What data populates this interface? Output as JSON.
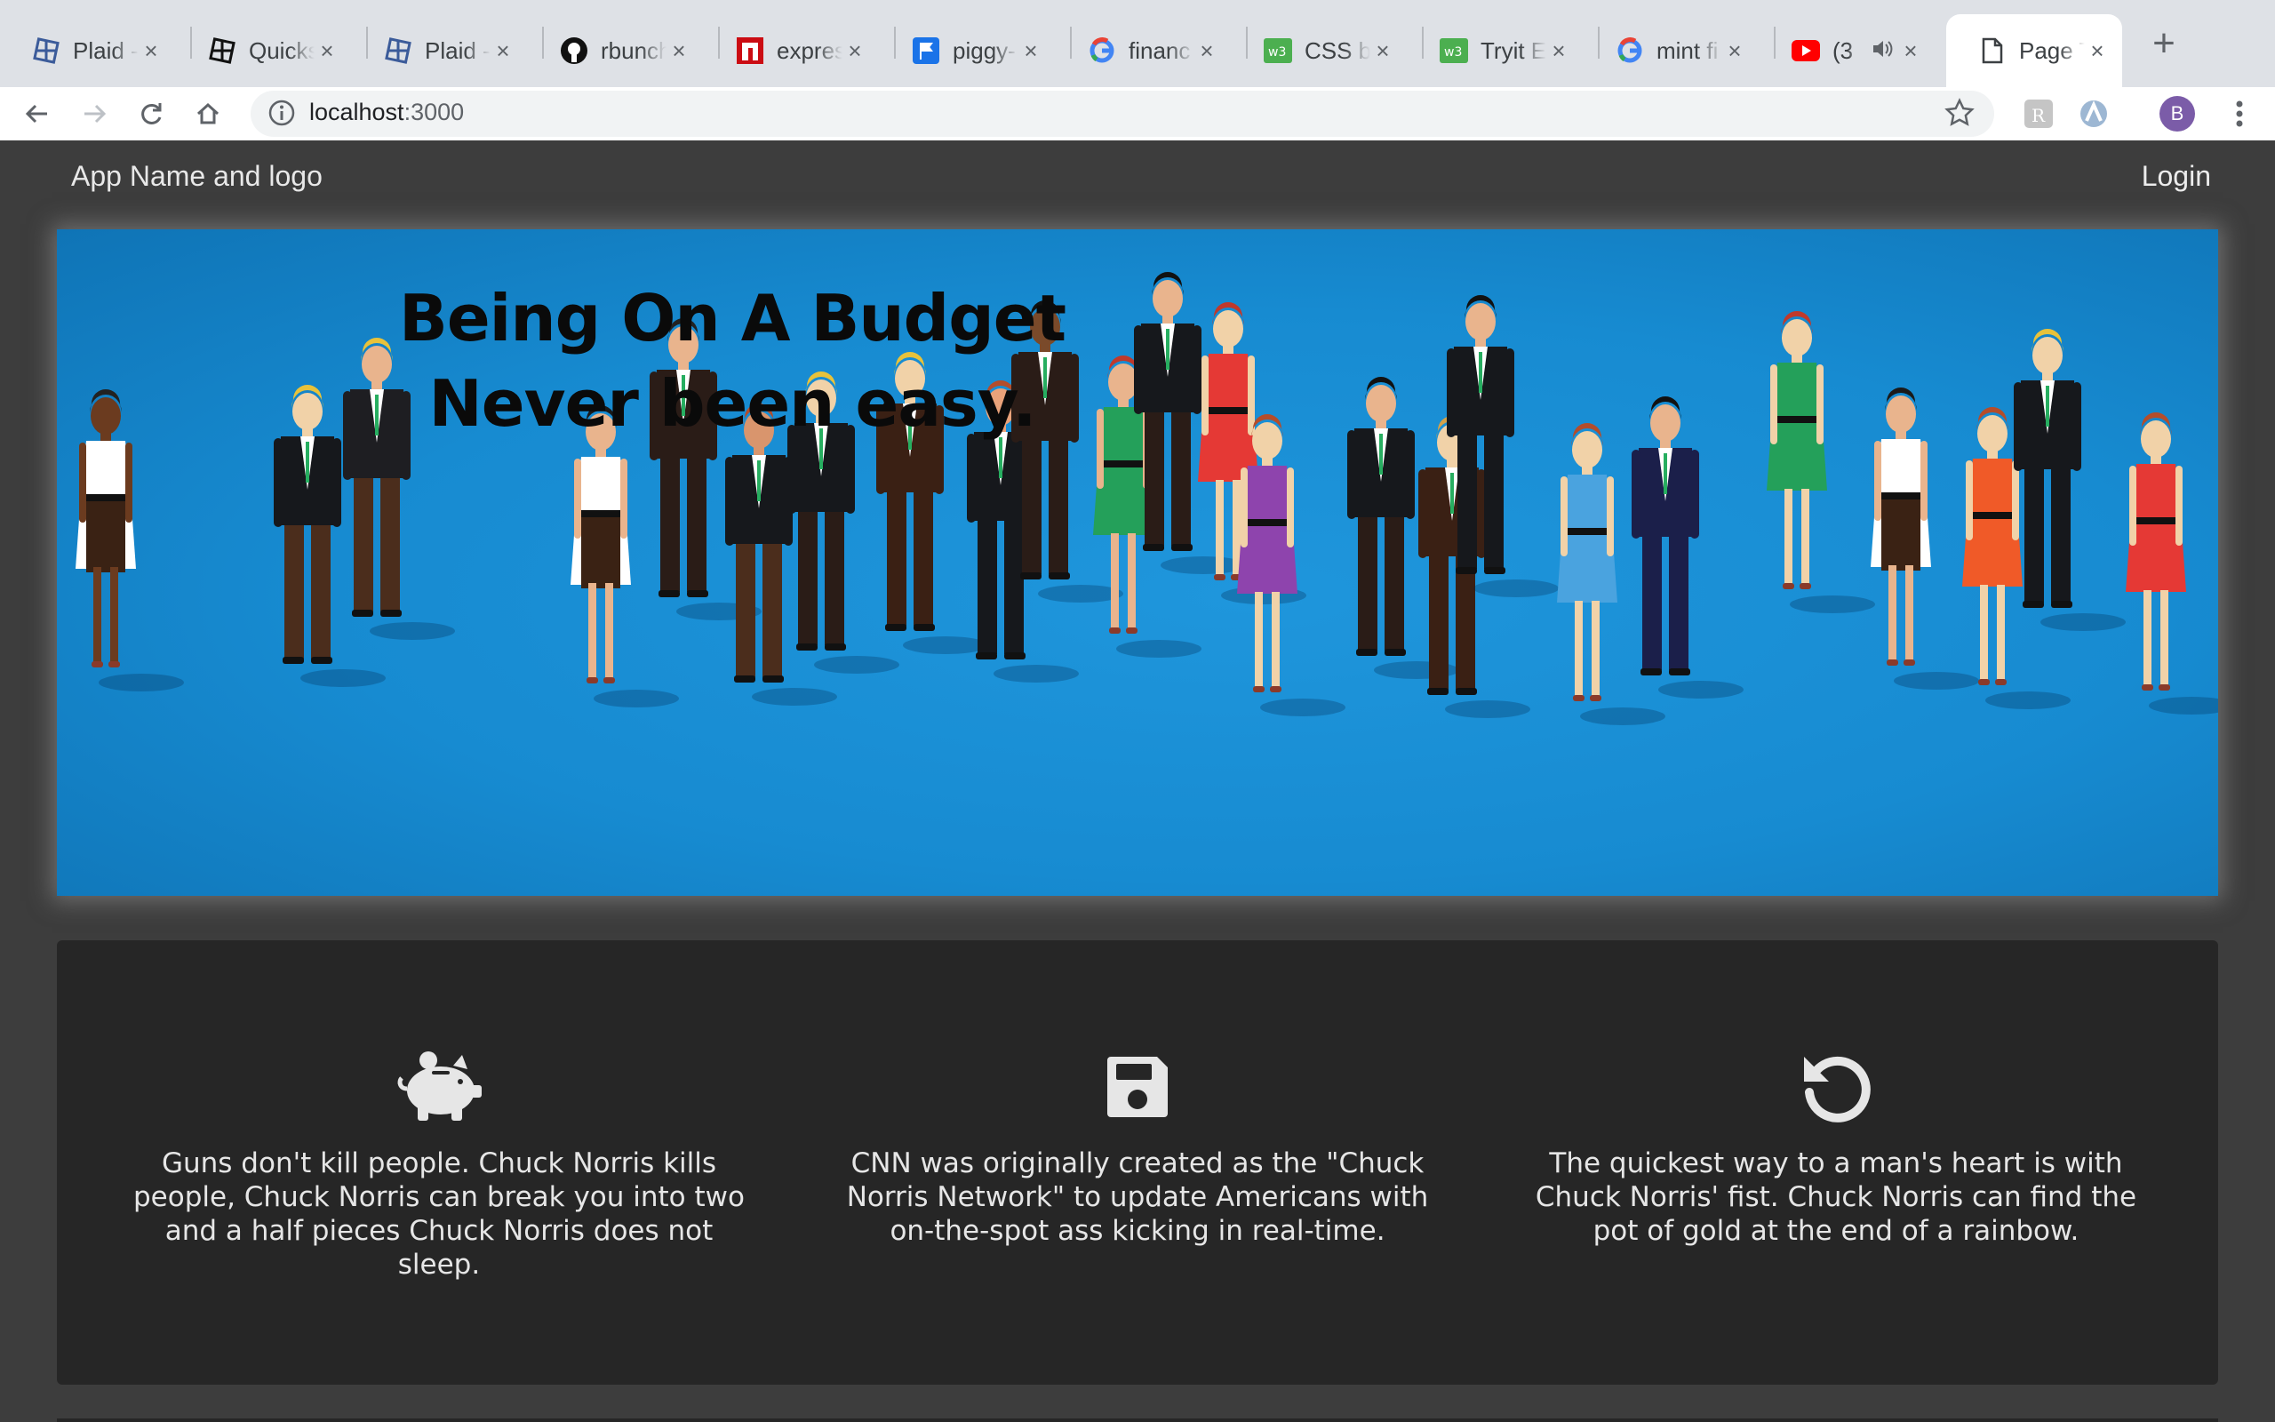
{
  "browser": {
    "tabs": [
      {
        "title": "Plaid -",
        "icon": "plaid-icon"
      },
      {
        "title": "Quickst",
        "icon": "plaid-icon"
      },
      {
        "title": "Plaid -",
        "icon": "plaid-icon"
      },
      {
        "title": "rbunch",
        "icon": "github-icon"
      },
      {
        "title": "express",
        "icon": "npm-icon"
      },
      {
        "title": "piggy-",
        "icon": "flag-icon"
      },
      {
        "title": "financ",
        "icon": "google-icon"
      },
      {
        "title": "CSS bu",
        "icon": "w3schools-icon"
      },
      {
        "title": "Tryit E",
        "icon": "w3schools-icon"
      },
      {
        "title": "mint fi",
        "icon": "google-icon"
      },
      {
        "title": "(3",
        "icon": "youtube-icon"
      },
      {
        "title": "Page T",
        "icon": "page-icon"
      }
    ],
    "url_host": "localhost",
    "url_port": ":3000",
    "profile_initial": "B"
  },
  "navbar": {
    "brand": "App Name and logo",
    "login": "Login"
  },
  "hero": {
    "line1": "Being On A Budget",
    "line2": "Never been easy."
  },
  "features": [
    {
      "icon": "piggy-bank-icon",
      "text": "Guns don't kill people. Chuck Norris kills people, Chuck Norris can break you into two and a half pieces Chuck Norris does not sleep."
    },
    {
      "icon": "floppy-disk-icon",
      "text": "CNN was originally created as the \"Chuck Norris Network\" to update Americans with on-the-spot ass kicking in real-time."
    },
    {
      "icon": "undo-icon",
      "text": "The quickest way to a man's heart is with Chuck Norris' fist. Chuck Norris can find the pot of gold at the end of a rainbow."
    }
  ],
  "colors": {
    "hero_bg": "#178bd1",
    "page_bg": "#3d3d3d",
    "panel_bg": "#262626"
  }
}
